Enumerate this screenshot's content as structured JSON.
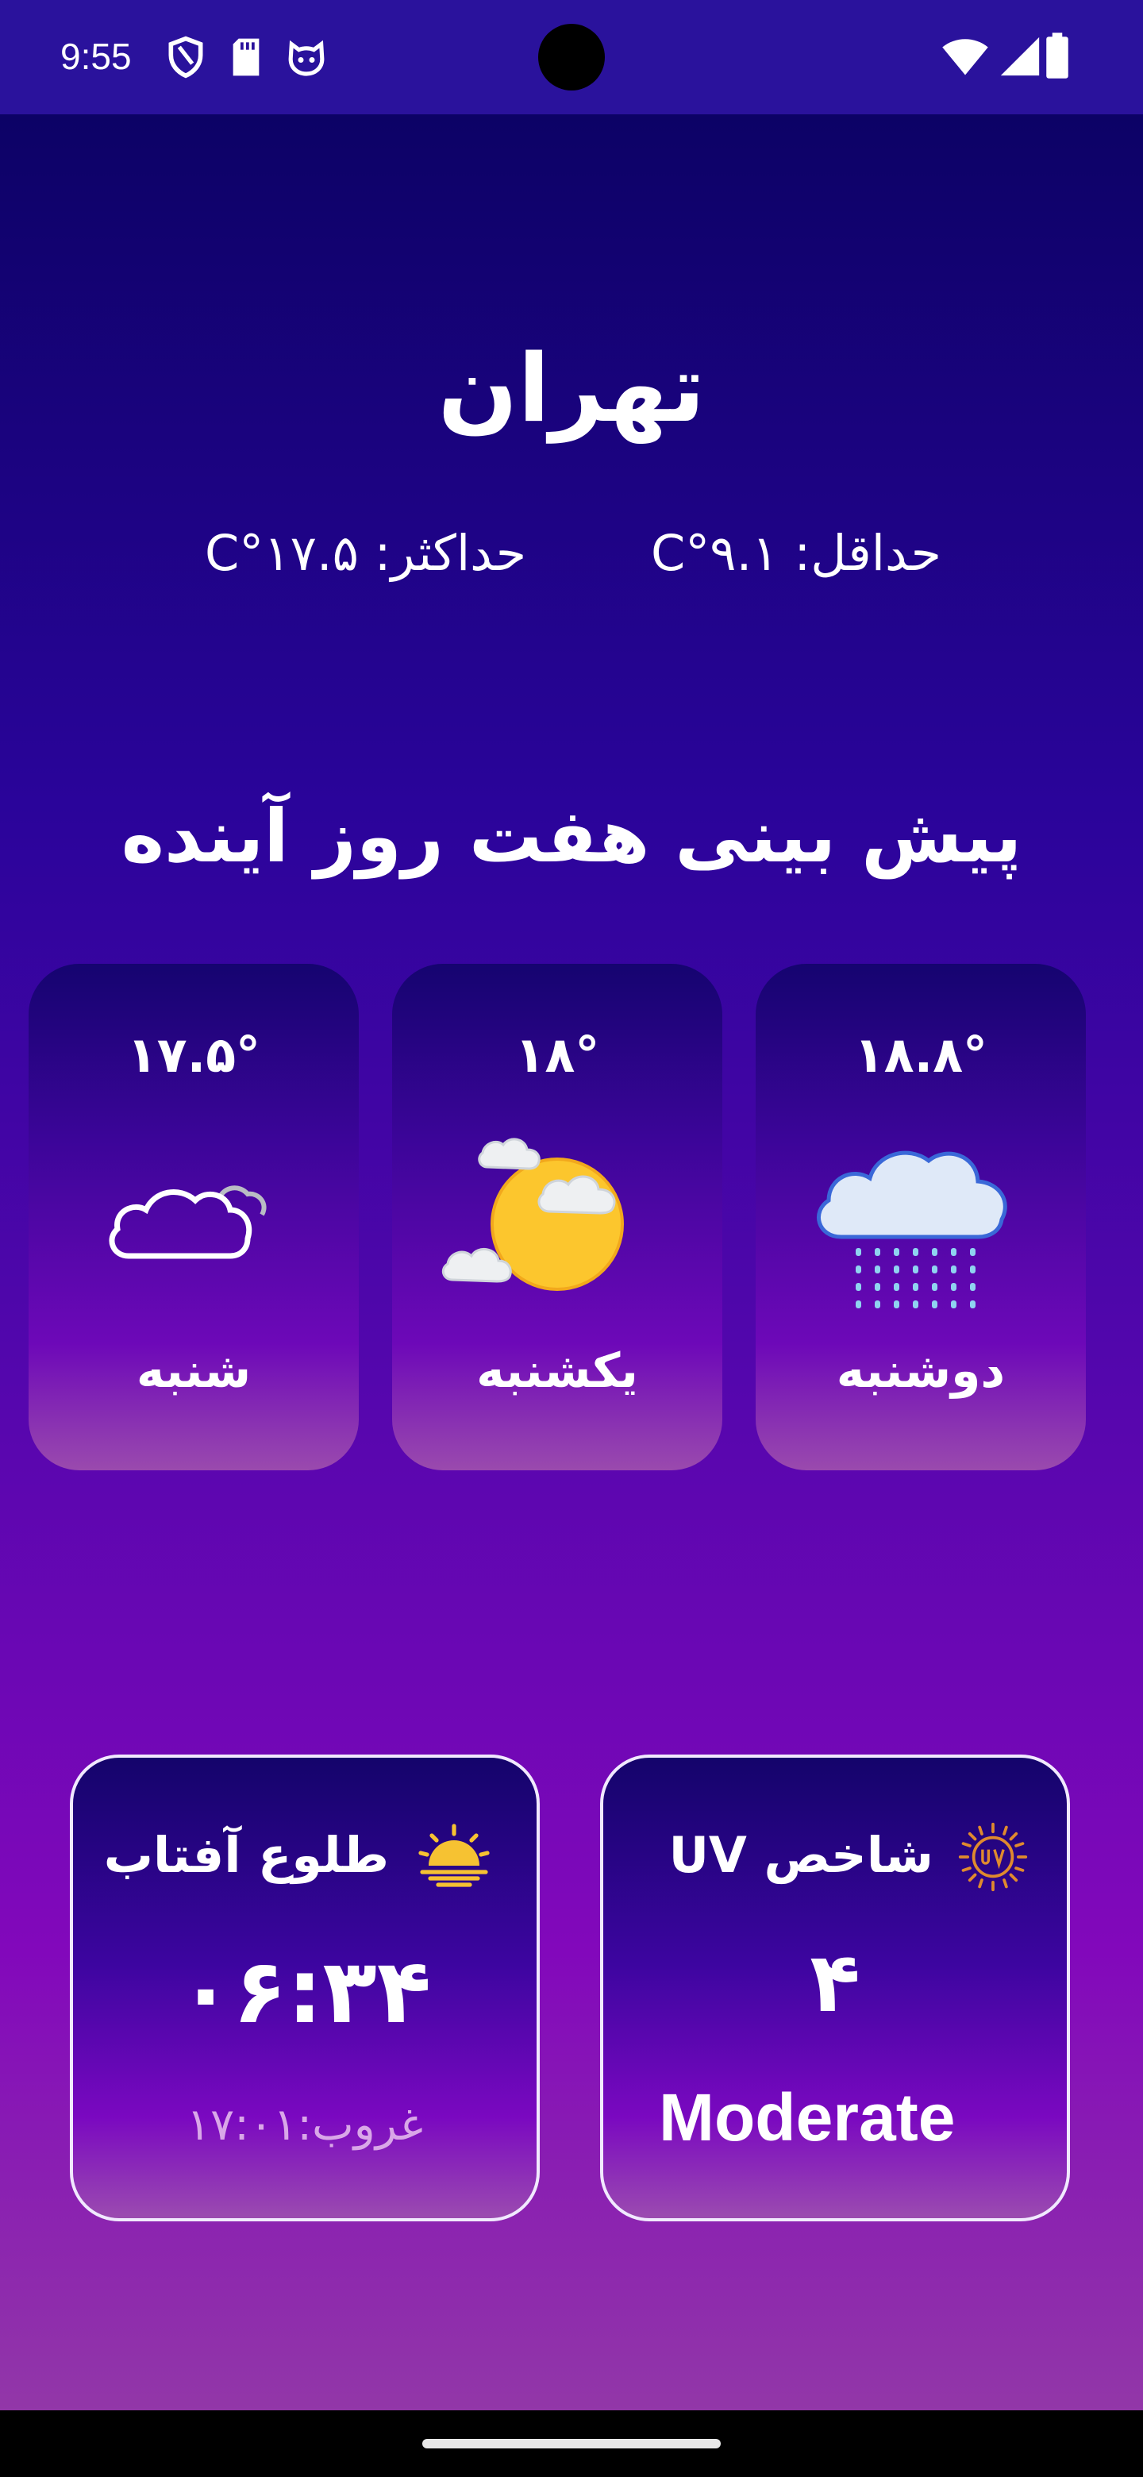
{
  "status_bar": {
    "time": "9:55",
    "left_icons": [
      "shield-icon",
      "sd-card-icon",
      "cat-face-icon"
    ],
    "right_icons": [
      "wifi-icon",
      "signal-icon",
      "battery-icon"
    ]
  },
  "weather": {
    "city": "تهران",
    "min_label": "حداقل: ۹.۱°C",
    "max_label": "حداکثر: ۱۷.۵°C"
  },
  "forecast": {
    "title": "پیش بینی هفت روز آینده",
    "days": [
      {
        "name": "دوشنبه",
        "temp": "۱۸.۸°",
        "icon": "rain-cloud-icon"
      },
      {
        "name": "یکشنبه",
        "temp": "۱۸°",
        "icon": "partly-cloudy-icon"
      },
      {
        "name": "شنبه",
        "temp": "۱۷.۵°",
        "icon": "cloud-icon"
      }
    ]
  },
  "sun_card": {
    "title": "طلوع آفتاب",
    "sunrise": "۰۶:۳۴",
    "sunset": "غروب:۱۷:۰۱",
    "icon": "sunrise-icon",
    "icon_color": "#f6c232"
  },
  "uv_card": {
    "title": "شاخص UV",
    "value": "۴",
    "level": "Moderate",
    "icon": "uv-sun-icon",
    "icon_color": "#e08a2e"
  },
  "colors": {
    "status_bar": "#2a129c",
    "background_top": "#0c0266",
    "background_bottom": "#9237a8",
    "card_border": "#f1e9ff",
    "sunset_text": "#d9a7e8"
  }
}
